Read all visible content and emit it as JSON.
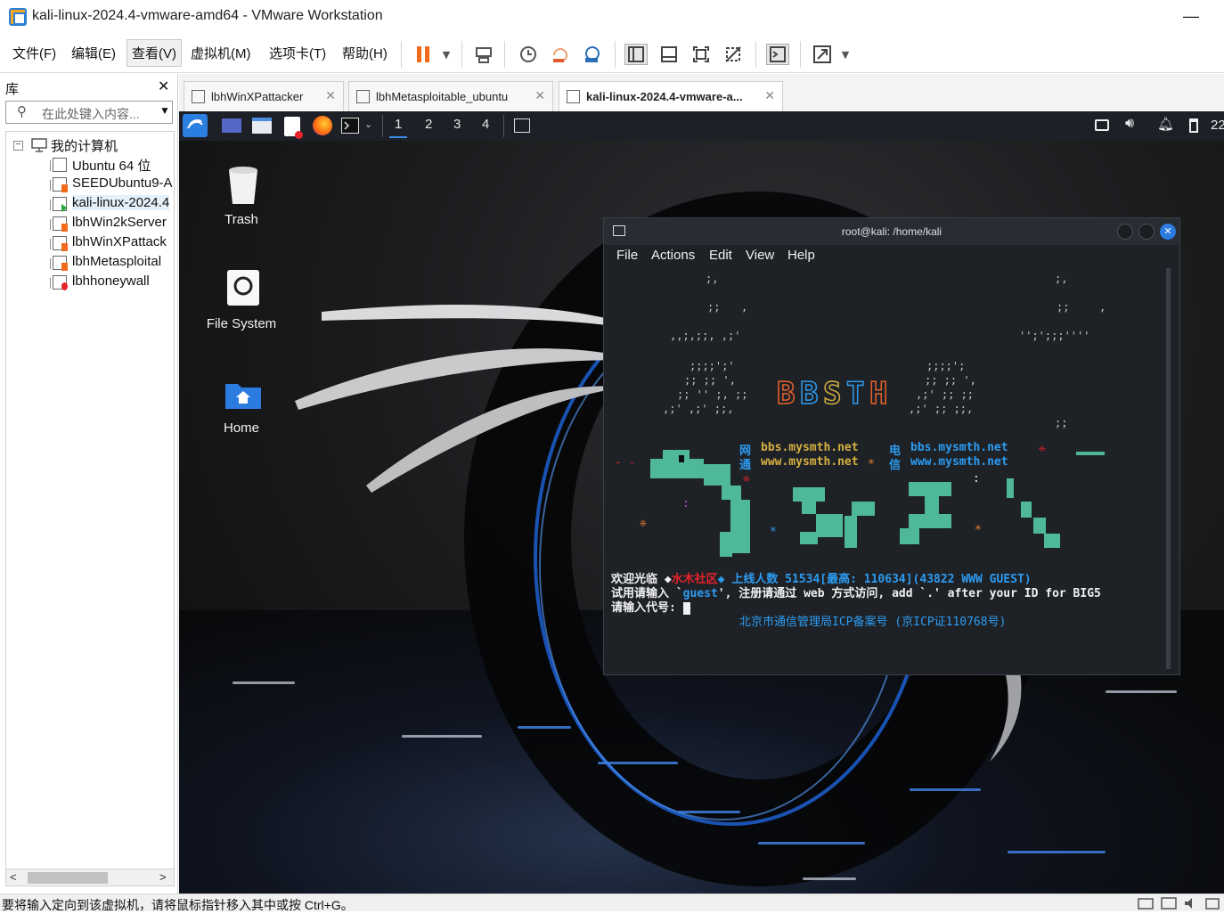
{
  "window": {
    "title": "kali-linux-2024.4-vmware-amd64 - VMware Workstation"
  },
  "menubar": {
    "items": [
      "文件(F)",
      "编辑(E)",
      "查看(V)",
      "虚拟机(M)",
      "选项卡(T)",
      "帮助(H)"
    ]
  },
  "library": {
    "heading": "库",
    "search_placeholder": "在此处键入内容...",
    "root": "我的计算机",
    "vms": [
      "Ubuntu 64 位",
      "SEEDUbuntu9-A",
      "kali-linux-2024.4",
      "lbhWin2kServer",
      "lbhWinXPattack",
      "lbhMetasploital",
      "lbhhoneywall"
    ]
  },
  "tabs": [
    {
      "label": "lbhWinXPattacker"
    },
    {
      "label": "lbhMetasploitable_ubuntu"
    },
    {
      "label": "kali-linux-2024.4-vmware-a..."
    }
  ],
  "kali": {
    "workspaces": [
      "1",
      "2",
      "3",
      "4"
    ],
    "clock": "22",
    "desktop_icons": [
      "Trash",
      "File System",
      "Home"
    ]
  },
  "terminal": {
    "title": "root@kali: /home/kali",
    "menu": [
      "File",
      "Actions",
      "Edit",
      "View",
      "Help"
    ],
    "side_label_1": "网",
    "side_label_2": "通",
    "side_label_3": "电",
    "side_label_4": "信",
    "net1_a": "bbs.mysmth.net",
    "net1_b": "www.mysmth.net",
    "net2_a": "bbs.mysmth.net",
    "net2_b": "www.mysmth.net",
    "welcome_prefix": "欢迎光临 ◆",
    "site_name": "水木社区",
    "welcome_stats_label": "◆ 上线人数 51534[最高: 110634](43822 WWW GUEST)",
    "line2_prefix": "试用请输入 `",
    "guest": "guest",
    "line2_suffix": "', 注册请通过 web 方式访问, add `.' after your ID for BIG5",
    "prompt": "请输入代号:",
    "icp": "北京市通信管理局ICP备案号 (京ICP证110768号)"
  },
  "statusbar": {
    "text": "要将输入定向到该虚拟机，请将鼠标指针移入其中或按 Ctrl+G。"
  },
  "colors": {
    "accent": "#3b8ee8",
    "pause": "#f26b1d",
    "ascii_green": "#4fb89a",
    "ascii_blue": "#2d9bf0",
    "red": "#e8222a"
  }
}
